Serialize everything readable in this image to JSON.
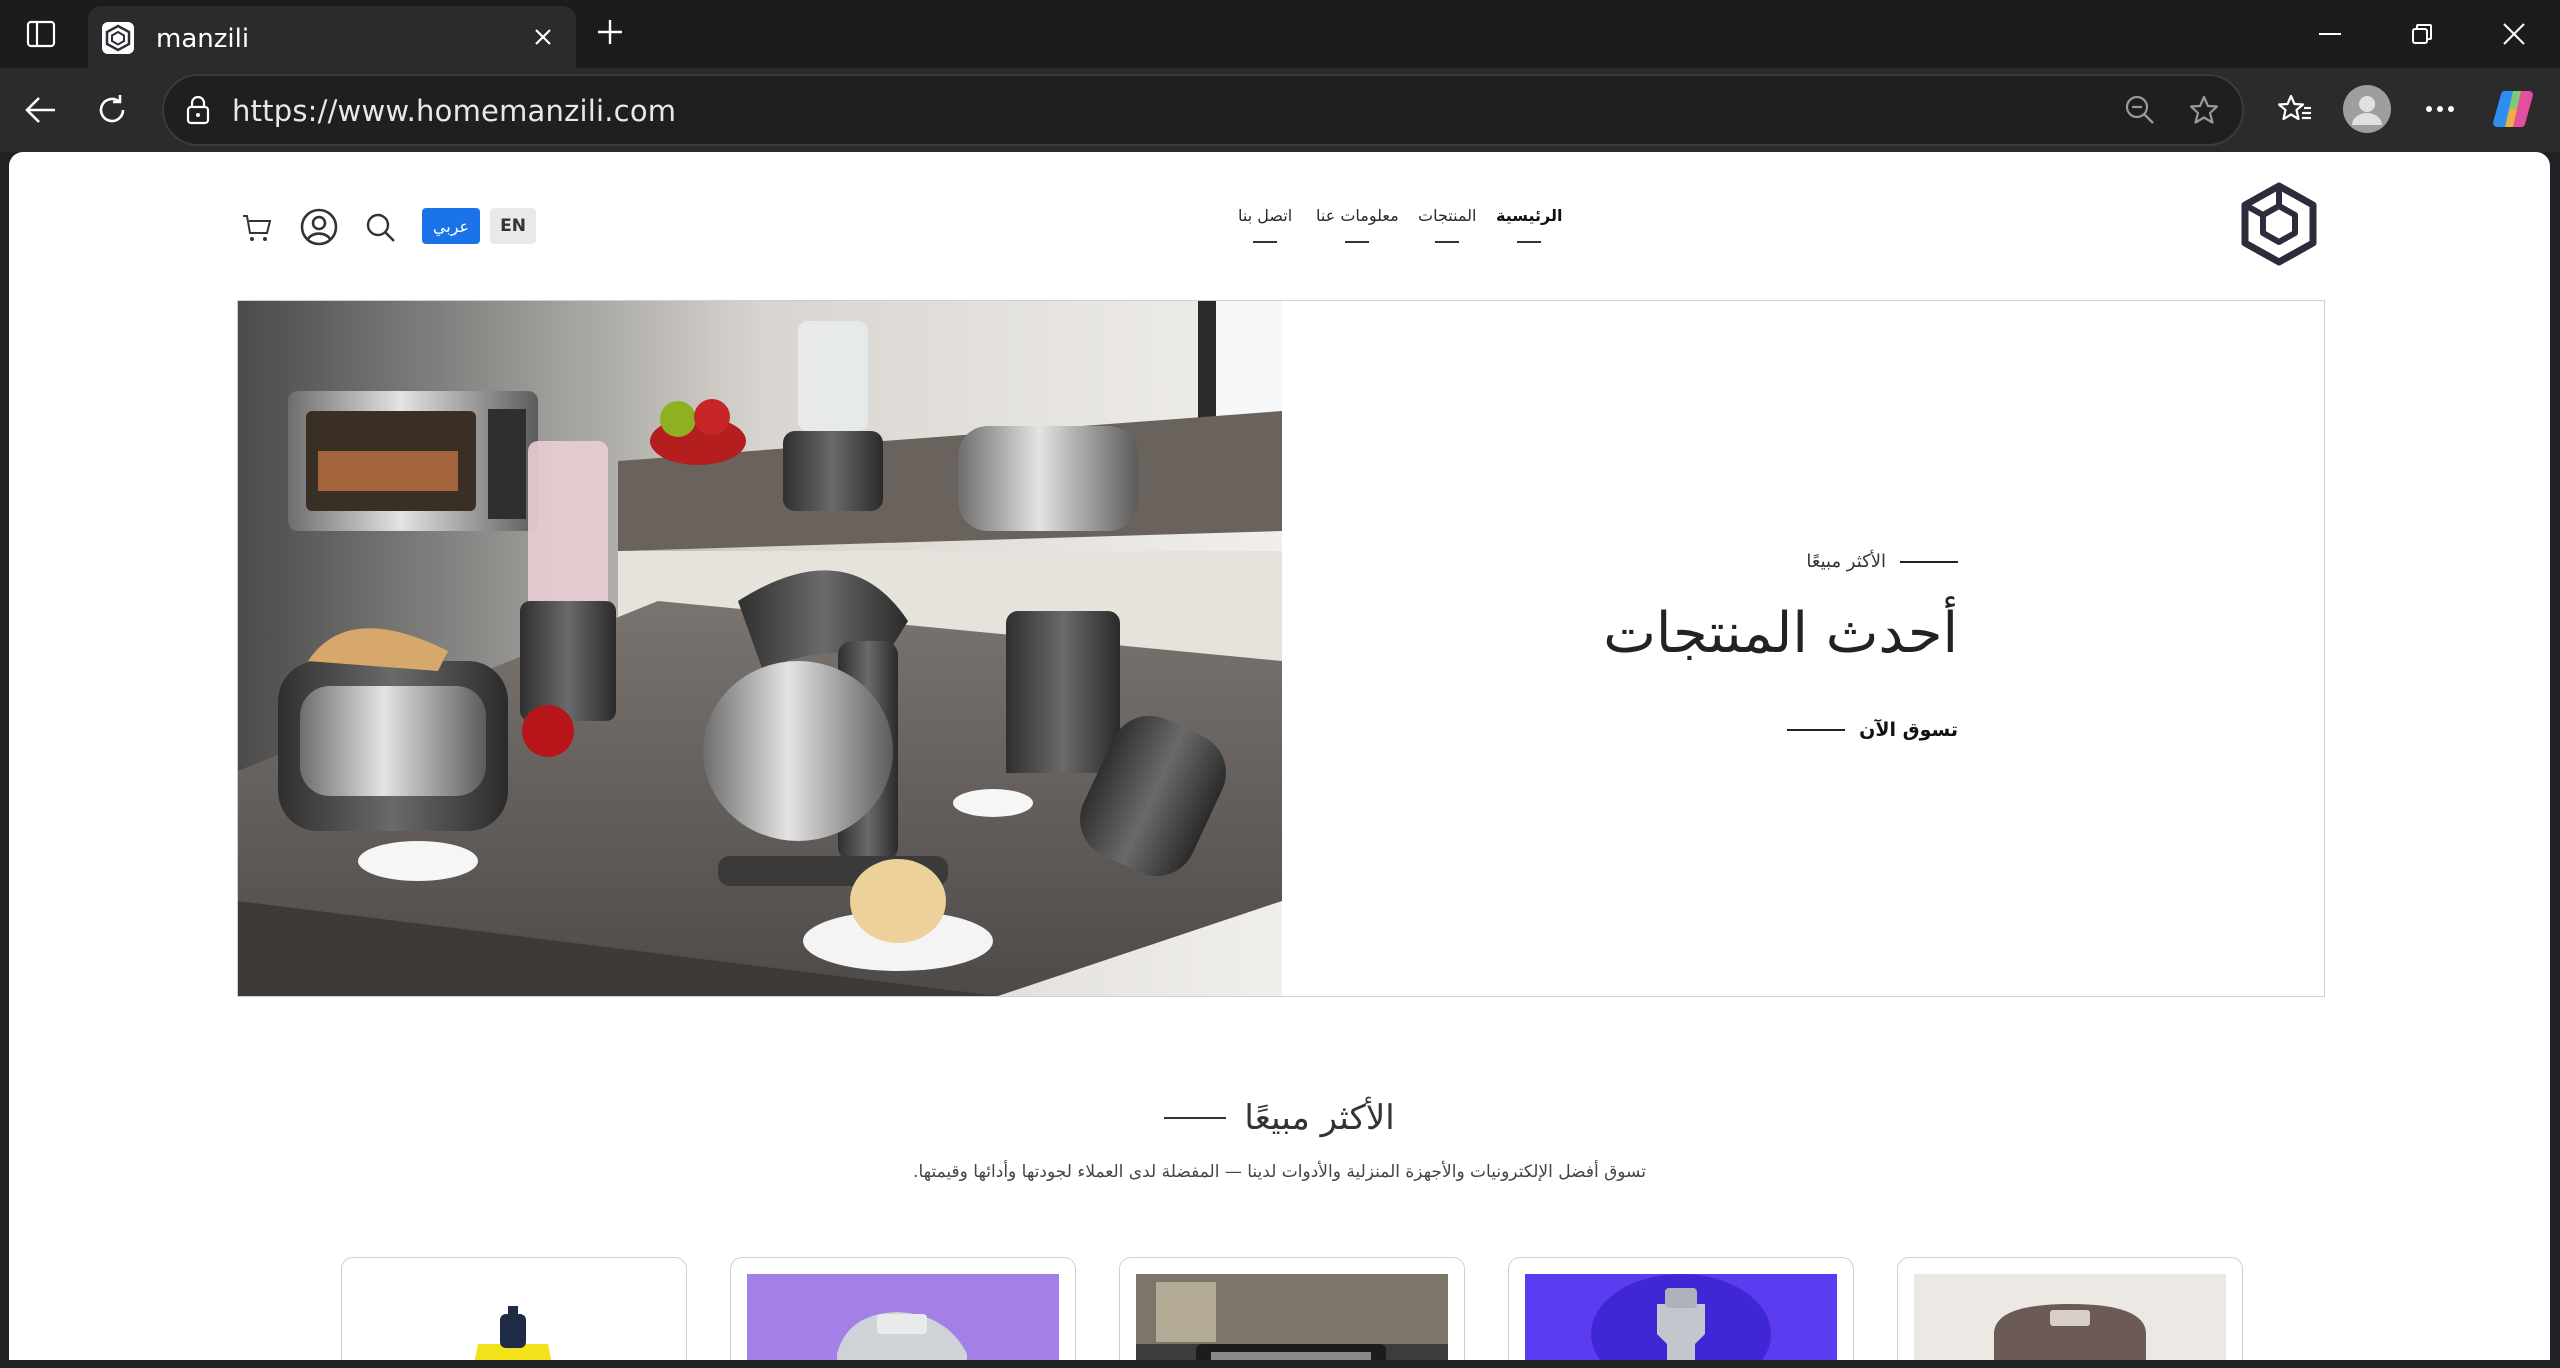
{
  "browser": {
    "tab_title": "manzili",
    "url": "https://www.homemanzili.com"
  },
  "site": {
    "nav": [
      {
        "label": "الرئيسية",
        "active": true
      },
      {
        "label": "المنتجات",
        "active": false
      },
      {
        "label": "معلومات عنا",
        "active": false
      },
      {
        "label": "اتصل بنا",
        "active": false
      }
    ],
    "lang_en": "EN",
    "lang_ar": "عربي"
  },
  "hero": {
    "eyebrow": "الأكثر مبيعًا",
    "title": "أحدث المنتجات",
    "cta": "تسوق الآن"
  },
  "best_sellers": {
    "title": "الأكثر مبيعًا",
    "subtitle": "تسوق أفضل الإلكترونيات والأجهزة المنزلية والأدوات لدينا — المفضلة لدى العملاء لجودتها وأدائها وقيمتها."
  },
  "colors": {
    "accent": "#1a73e8",
    "chrome_dark": "#1c1c1c",
    "chrome_toolbar": "#2b2b2b"
  },
  "icons": [
    "sidebar-icon",
    "close-icon",
    "new-tab-icon",
    "minimize-icon",
    "restore-icon",
    "window-close-icon",
    "back-icon",
    "refresh-icon",
    "lock-icon",
    "zoom-out-icon",
    "favorite-star-icon",
    "favorites-icon",
    "profile-icon",
    "more-icon",
    "copilot-icon",
    "cart-icon",
    "account-icon",
    "search-icon",
    "site-logo"
  ]
}
